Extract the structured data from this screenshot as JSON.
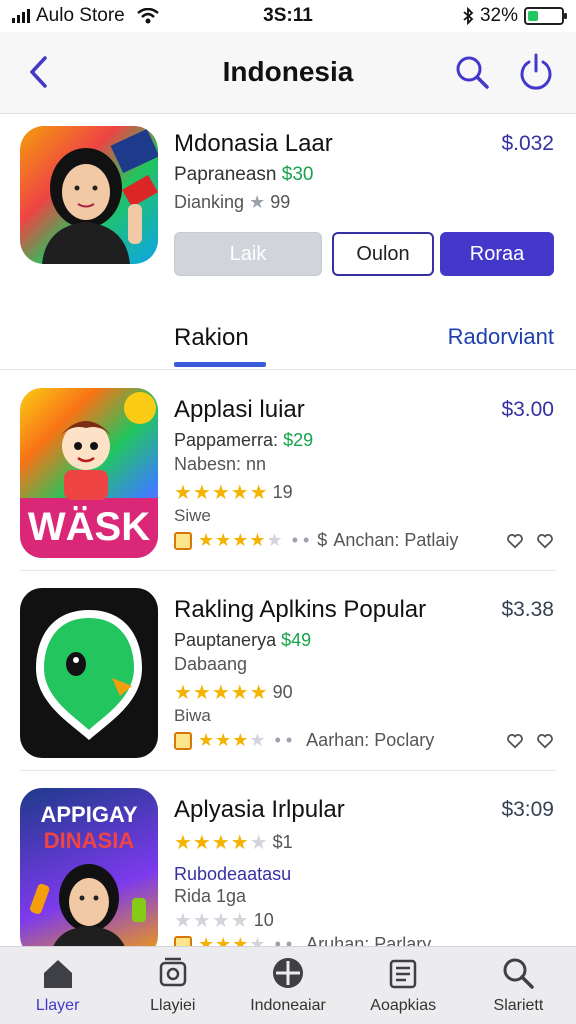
{
  "status_bar": {
    "carrier": "Aulo Store",
    "time": "3S:11",
    "battery": "32%",
    "battery_level": 0.32,
    "battery_color": "#22c55e"
  },
  "nav": {
    "title": "Indonesia",
    "accent": "#3730a3"
  },
  "featured": {
    "name": "Mdonasia Laar",
    "price": "$.032",
    "subtitle_text": "Papraneasn",
    "subtitle_price": "$30",
    "rank_text": "Dianking",
    "rank_value": "99",
    "buttons": {
      "like": "Laik",
      "outline": "Oulon",
      "primary": "Roraa"
    }
  },
  "tabs": {
    "active": "Rakion",
    "other": "Radorviant"
  },
  "apps": [
    {
      "name": "Applasi  luiar",
      "price": "$3.00",
      "price_color": "#3730a3",
      "sub_text": "Pappamerra:",
      "sub_price": "$29",
      "sub2": "Nabesn: nn",
      "rating_count": "19",
      "stars_filled": 5,
      "small": "Siwe",
      "bottom_suffix": "$",
      "author": "Anchan: Patlaiy",
      "icon_label": "WÄSK"
    },
    {
      "name": "Rakling Aplkins Popular",
      "price": "$3.38",
      "price_color": "#374151",
      "sub_text": "Pauptanerya",
      "sub_price": "$49",
      "sub2": "Dabaang",
      "rating_count": "90",
      "stars_filled": 5,
      "small": "Biwa",
      "bottom_suffix": "",
      "author": "Aarhan: Poclary",
      "icon_label": ""
    },
    {
      "name": "Aplyasia Irlpular",
      "price": "$3:09",
      "price_color": "#374151",
      "sub_text": "",
      "sub_price": "",
      "sub2": "",
      "rating_count": "$1",
      "stars_filled": 4,
      "small": "Rubodeaatasu",
      "bottom_suffix": "",
      "author": "Aruhan: Parlary",
      "icon_label": "APPIGAY DINASIA",
      "extra_line": "Rida 1ga",
      "extra_rating": "10"
    }
  ],
  "tab_bar": [
    {
      "label": "Llayer",
      "icon": "home-icon"
    },
    {
      "label": "Llayiei",
      "icon": "game-icon"
    },
    {
      "label": "Indoneaiar",
      "icon": "globe-icon"
    },
    {
      "label": "Aoapkias",
      "icon": "apps-icon"
    },
    {
      "label": "Slariett",
      "icon": "search-icon"
    }
  ]
}
